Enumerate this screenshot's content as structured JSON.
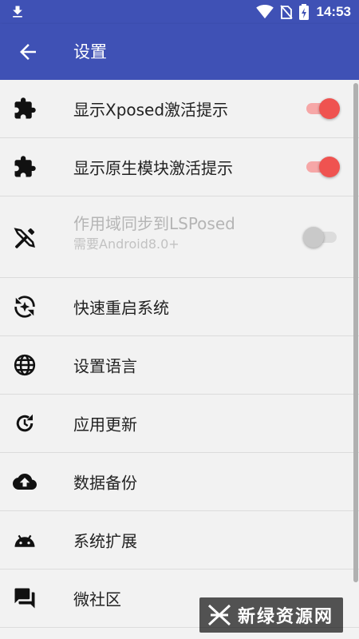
{
  "status_bar": {
    "time": "14:53"
  },
  "app_bar": {
    "title": "设置"
  },
  "items": [
    {
      "label": "显示Xposed激活提示",
      "icon": "puzzle-icon",
      "switch": "on"
    },
    {
      "label": "显示原生模块激活提示",
      "icon": "puzzle-icon",
      "switch": "on"
    },
    {
      "label": "作用域同步到LSPosed",
      "sublabel": "需要Android8.0+",
      "icon": "tools-icon",
      "switch": "off",
      "disabled": true
    },
    {
      "label": "快速重启系统",
      "icon": "restart-icon"
    },
    {
      "label": "设置语言",
      "icon": "globe-icon"
    },
    {
      "label": "应用更新",
      "icon": "update-icon"
    },
    {
      "label": "数据备份",
      "icon": "cloud-upload-icon"
    },
    {
      "label": "系统扩展",
      "icon": "android-icon"
    },
    {
      "label": "微社区",
      "icon": "forum-icon"
    }
  ],
  "watermark": {
    "text": "新绿资源网"
  },
  "colors": {
    "primary": "#3f51b5",
    "switch_on": "#ef5350",
    "background": "#f2f2f2"
  }
}
